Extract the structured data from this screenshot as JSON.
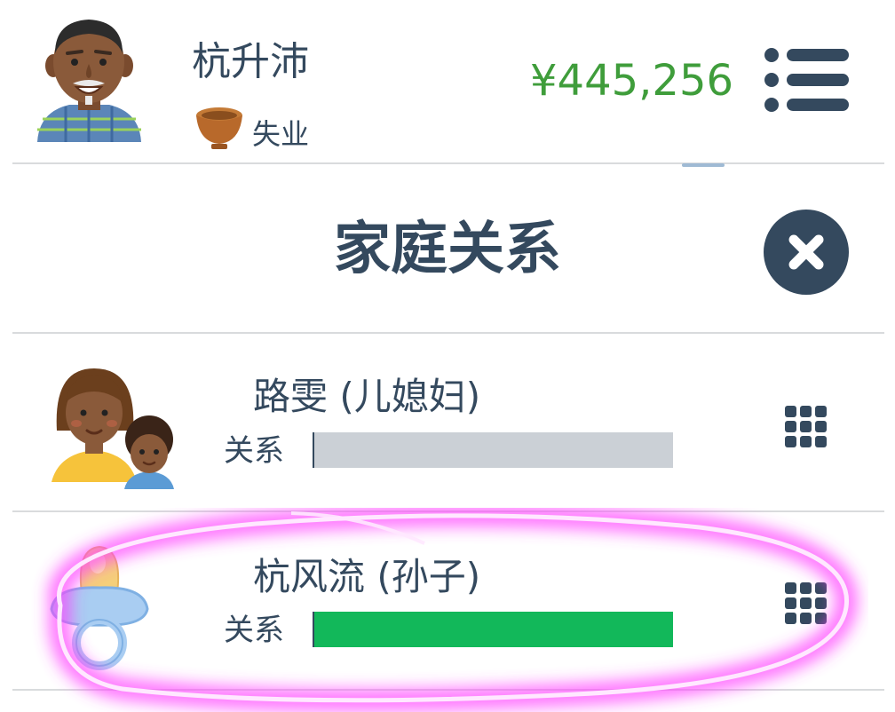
{
  "header": {
    "player_name": "杭升沛",
    "avatar_icon": "elderly-man-avatar-icon",
    "job_icon": "empty-bowl-icon",
    "job_label": "失业",
    "money": "¥445,256",
    "menu_icon": "list-menu-icon"
  },
  "modal": {
    "title": "家庭关系",
    "close_icon": "close-icon"
  },
  "relations": [
    {
      "name": "路雯 (儿媳妇)",
      "avatar_icon": "mother-with-child-avatar-icon",
      "relation_label": "关系",
      "relation_level": 0.0,
      "relation_color": "#cbd0d6",
      "action_icon": "grid-menu-icon"
    },
    {
      "name": "杭风流 (孙子)",
      "avatar_icon": "baby-pacifier-icon",
      "relation_label": "关系",
      "relation_level": 1.0,
      "relation_color": "#12b85a",
      "action_icon": "grid-menu-icon"
    }
  ],
  "colors": {
    "text": "#34495e",
    "money": "#3f9d3b",
    "highlight": "#ff3cff"
  }
}
